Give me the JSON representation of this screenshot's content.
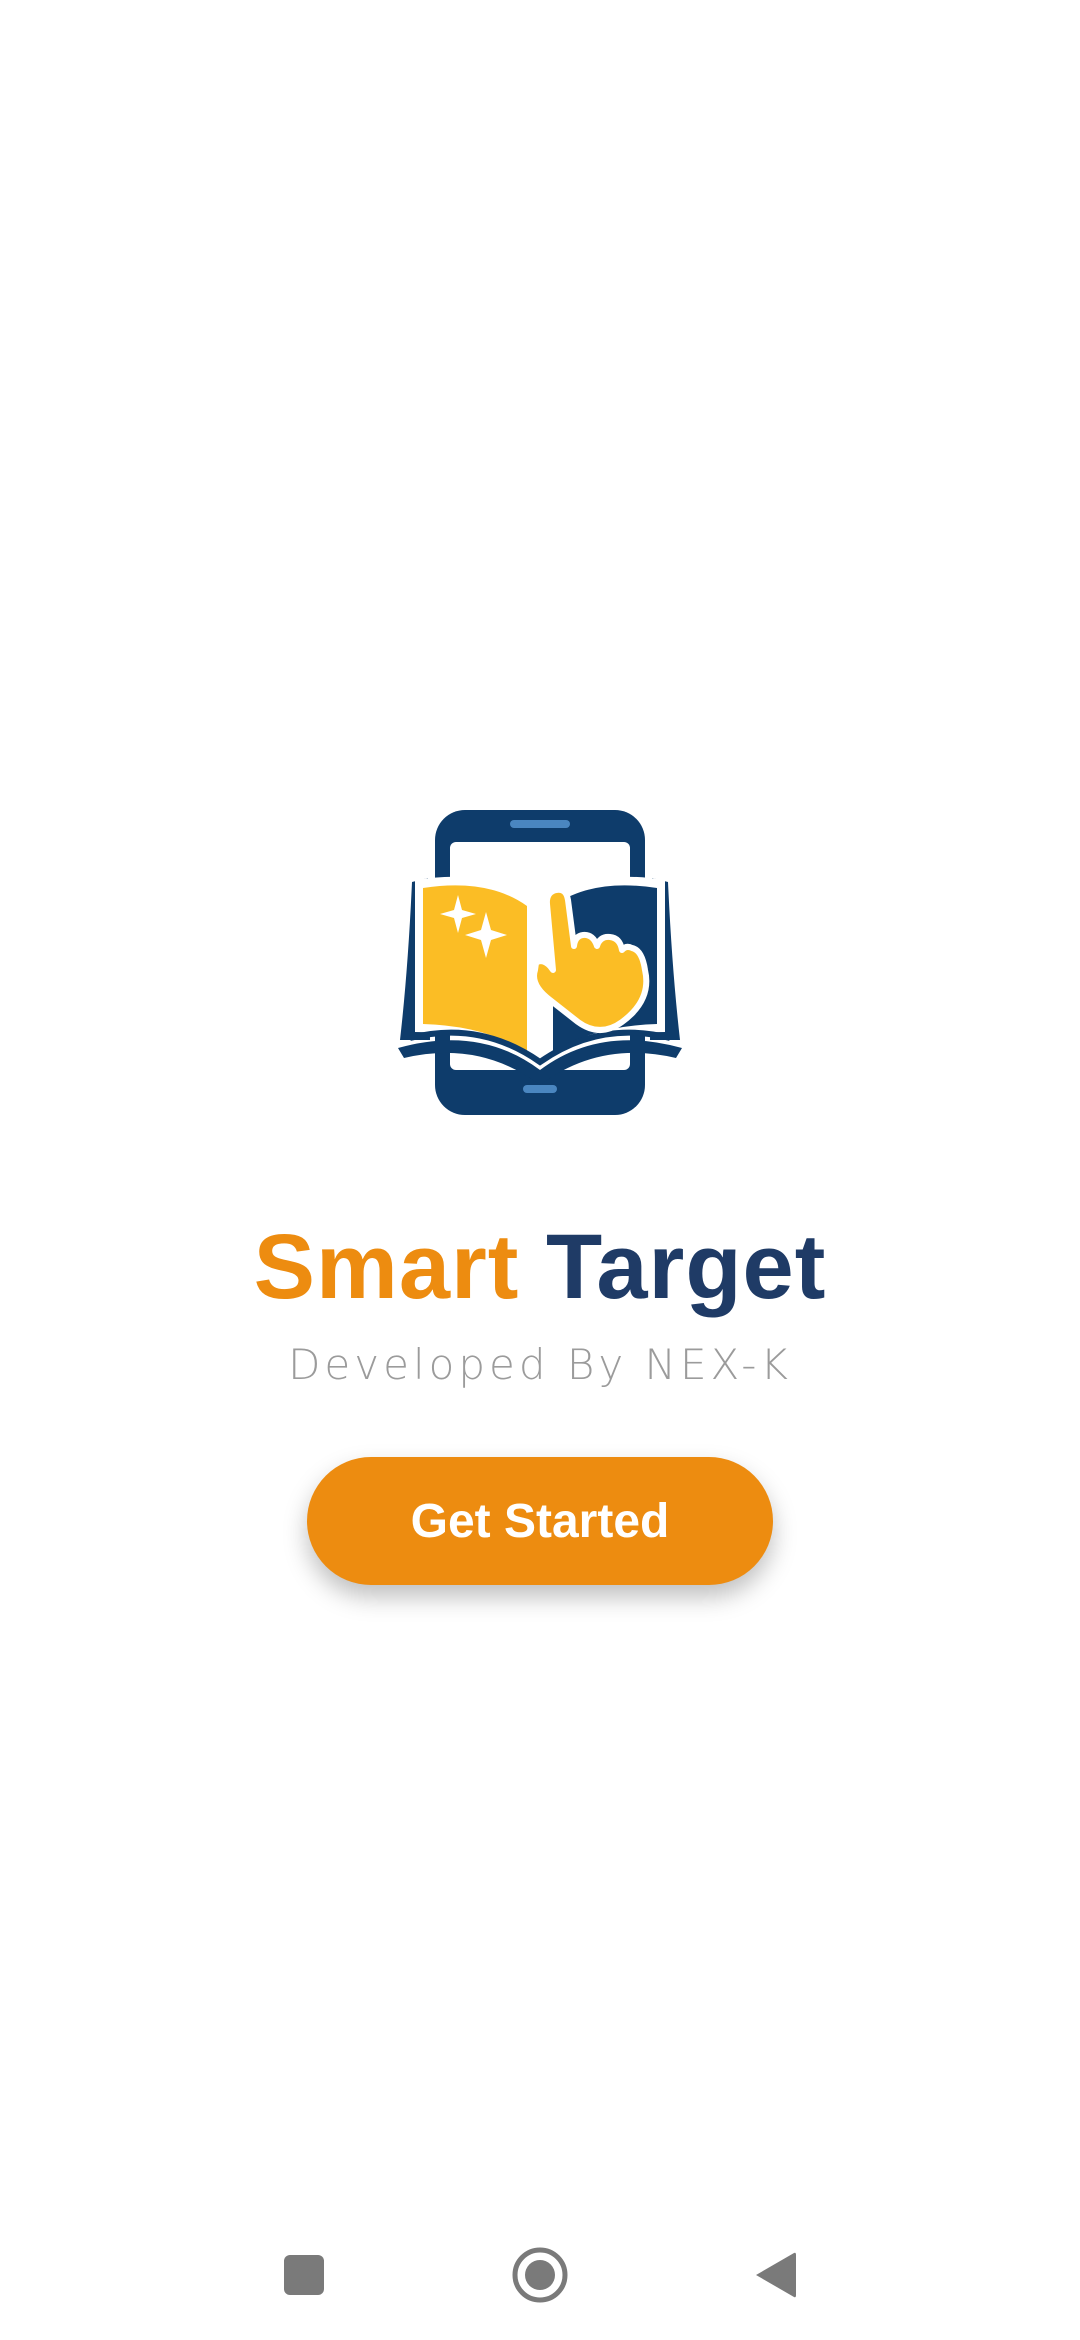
{
  "app": {
    "title_part1": "Smart",
    "title_part2": "Target",
    "subtitle": "Developed By NEX-K"
  },
  "cta": {
    "label": "Get Started"
  },
  "icons": {
    "logo": "phone-book-touch-logo",
    "recents": "recents-square-icon",
    "home": "home-circle-icon",
    "back": "back-triangle-icon"
  },
  "colors": {
    "accent": "#ED8C10",
    "brand_dark": "#1F3B66",
    "logo_blue": "#0E3C6B",
    "logo_yellow": "#FBBD25",
    "subtitle_gray": "#9B9B9B",
    "nav_gray": "#7A7A7A"
  }
}
